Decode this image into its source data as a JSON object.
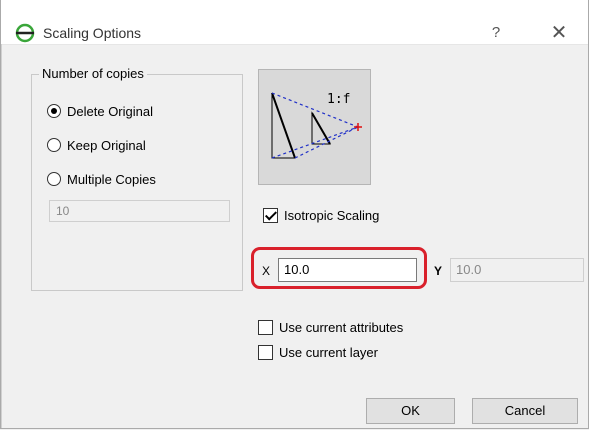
{
  "window": {
    "title": "Scaling Options",
    "help_glyph": "?",
    "close_glyph": "✕",
    "icon": "scaling-app-icon"
  },
  "copies": {
    "group_label": "Number of copies",
    "options": [
      {
        "label": "Delete Original",
        "selected": true
      },
      {
        "label": "Keep Original",
        "selected": false
      },
      {
        "label": "Multiple Copies",
        "selected": false
      }
    ],
    "count_value": "10"
  },
  "preview": {
    "ratio_label": "1:f"
  },
  "scaling": {
    "isotropic_label": "Isotropic Scaling",
    "isotropic_checked": true,
    "x_label": "X",
    "x_value": "10.0",
    "y_label": "Y",
    "y_value": "10.0"
  },
  "options": {
    "use_attributes_label": "Use current attributes",
    "use_attributes_checked": false,
    "use_layer_label": "Use current layer",
    "use_layer_checked": false
  },
  "buttons": {
    "ok_label": "OK",
    "cancel_label": "Cancel"
  },
  "colors": {
    "highlight": "#d9202b",
    "app_icon": "#3aa63a",
    "preview_lines": "#2030c8",
    "preview_marker": "#e01010"
  }
}
